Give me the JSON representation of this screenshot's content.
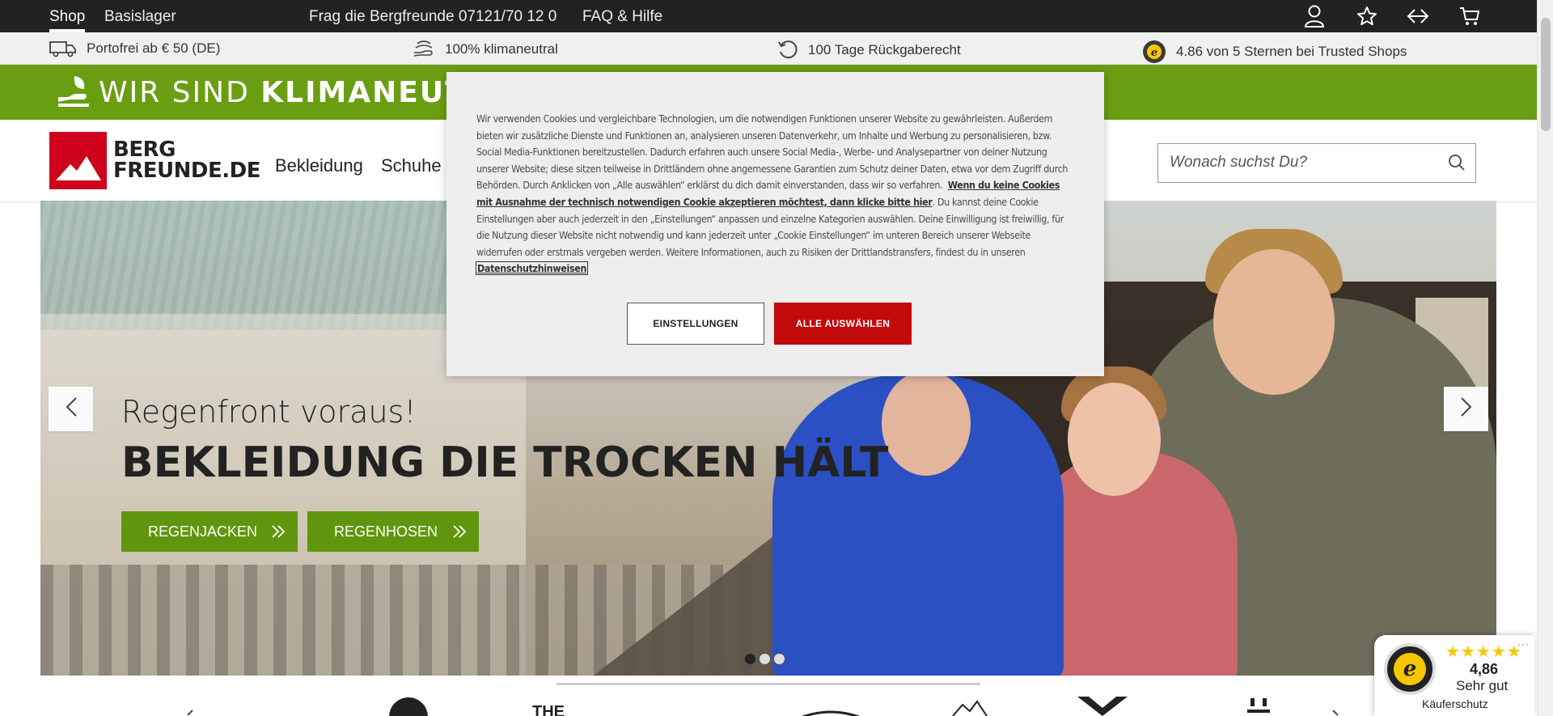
{
  "topbar": {
    "shop": "Shop",
    "basislager": "Basislager",
    "phone": "Frag die Bergfreunde 07121/70 12 0",
    "faq": "FAQ & Hilfe",
    "icons": [
      "user-icon",
      "star-icon",
      "compare-icon",
      "cart-icon"
    ]
  },
  "usp": {
    "shipping": "Portofrei ab € 50 (DE)",
    "climate": "100% klimaneutral",
    "returns": "100 Tage Rückgaberecht",
    "trusted": "4.86 von 5 Sternen bei Trusted Shops"
  },
  "banner": {
    "part1": "WIR SIND ",
    "part2": "KLIMANEUTRAL"
  },
  "header": {
    "logo_line1": "BERG",
    "logo_line2": "FREUNDE.DE",
    "nav": [
      "Bekleidung",
      "Schuhe"
    ],
    "search_placeholder": "Wonach suchst Du?"
  },
  "hero": {
    "subline": "Regenfront voraus!",
    "headline": "BEKLEIDUNG DIE TROCKEN HÄLT",
    "cta1": "REGENJACKEN",
    "cta2": "REGENHOSEN",
    "active_slide": 1,
    "slide_count": 3
  },
  "cookie": {
    "text1": "Wir verwenden Cookies und vergleichbare Technologien, um die notwendigen Funktionen unserer Website zu gewährleisten. Außerdem bieten wir zusätzliche Dienste und Funktionen an, analysieren unseren Datenverkehr, um Inhalte und Werbung zu personalisieren, bzw. Social Media-Funktionen bereitzustellen. Dadurch erfahren auch unsere Social Media-, Werbe- und Analysepartner von deiner Nutzung unserer Website; diese sitzen teilweise in Drittländern ohne angemessene Garantien zum Schutz deiner Daten, etwa vor dem Zugriff durch Behörden. Durch Anklicken von „Alle auswählen“ erklärst du dich damit einverstanden, dass wir so verfahren.",
    "bold": "Wenn du keine Cookies mit Ausnahme der technisch notwendigen Cookie akzeptieren möchtest, dann klicke bitte hier",
    "text2": ". Du kannst deine Cookie Einstellungen aber auch jederzeit in den „Einstellungen“ anpassen und einzelne Kategorien auswählen. Deine Einwilligung ist freiwillig, für die Nutzung dieser Website nicht notwendig und kann jederzeit unter „Cookie Einstellungen“ im unteren Bereich unserer Webseite widerrufen oder erstmals vergeben werden. Weitere Informationen, auch zu Risiken der Drittlandstransfers, findest du in unseren",
    "link": "Datenschutzhinweisen",
    "btn_settings": "EINSTELLUNGEN",
    "btn_all": "ALLE AUSWÄHLEN"
  },
  "brands": {
    "items": [
      "THE"
    ]
  },
  "trusted_badge": {
    "stars": "★★★★★",
    "score": "4,86",
    "rating": "Sehr gut",
    "protection": "Käuferschutz",
    "seal_letter": "e",
    "menu": "···"
  },
  "colors": {
    "green": "#6a9e12",
    "brand_red": "#d0021b",
    "cookie_red": "#c20a0a",
    "topbar": "#222222"
  }
}
